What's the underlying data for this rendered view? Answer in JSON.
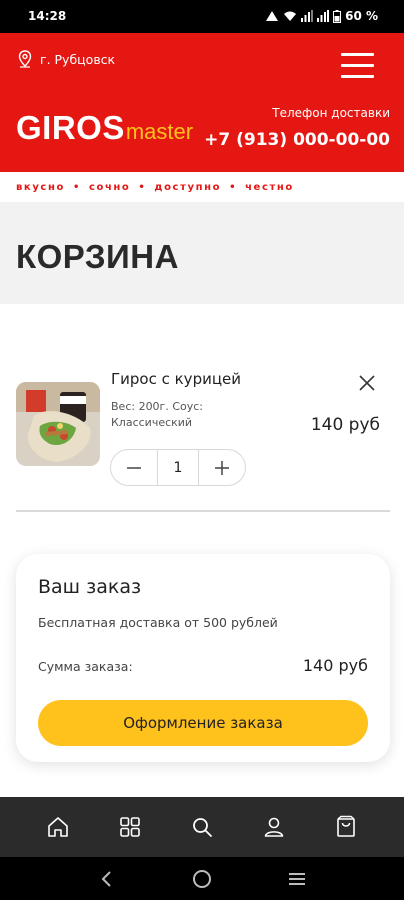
{
  "status_bar": {
    "time": "14:28",
    "battery": "60 %"
  },
  "header": {
    "city": "г. Рубцовск",
    "logo_main": "GIROS",
    "logo_sub": "master",
    "phone_label": "Телефон доставки",
    "phone": "+7 (913) 000-00-00",
    "slogans": [
      "вкусно",
      "сочно",
      "доступно",
      "честно"
    ]
  },
  "page": {
    "title": "КОРЗИНА"
  },
  "cart": {
    "items": [
      {
        "name": "Гирос с курицей",
        "description": "Вес: 200г. Соус: Классический",
        "quantity": "1",
        "price": "140 руб"
      }
    ]
  },
  "order": {
    "title": "Ваш заказ",
    "delivery_note": "Бесплатная доставка от 500 рублей",
    "sum_label": "Сумма заказа:",
    "sum_value": "140 руб",
    "checkout_label": "Оформление заказа"
  },
  "bottom_nav": [
    "home-icon",
    "catalog-icon",
    "search-icon",
    "profile-icon",
    "cart-icon"
  ],
  "colors": {
    "brand_red": "#e41713",
    "accent_yellow": "#ffc21c",
    "nav_bg": "#2b2b2b"
  }
}
